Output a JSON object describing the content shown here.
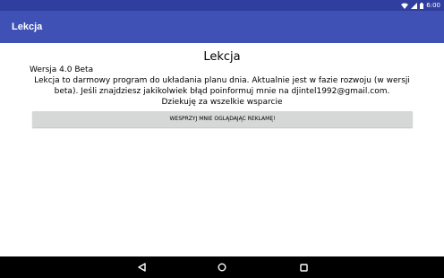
{
  "status_bar": {
    "time": "6:00",
    "icons": [
      "wifi-icon",
      "cellular-signal-icon",
      "battery-icon"
    ],
    "color": "#303f9f"
  },
  "app_bar": {
    "title": "Lekcja",
    "color": "#3f51b5"
  },
  "main": {
    "title": "Lekcja",
    "version": "Wersja 4.0 Beta",
    "description_line1": "Lekcja to darmowy program do układania planu dnia. Aktualnie jest w fazie rozwoju (w wersji",
    "description_line2": "beta). Jeśli znajdziesz jakikolwiek błąd poinformuj mnie na djintel1992@gmail.com.",
    "thanks": "Dziekuję za wszelkie wsparcie",
    "ad_button_label": "WESPRZYJ MNIE OGLĄDAJĄC REKLAMĘ!"
  },
  "nav_bar": {
    "buttons": [
      "back-icon",
      "home-icon",
      "recents-icon"
    ]
  }
}
